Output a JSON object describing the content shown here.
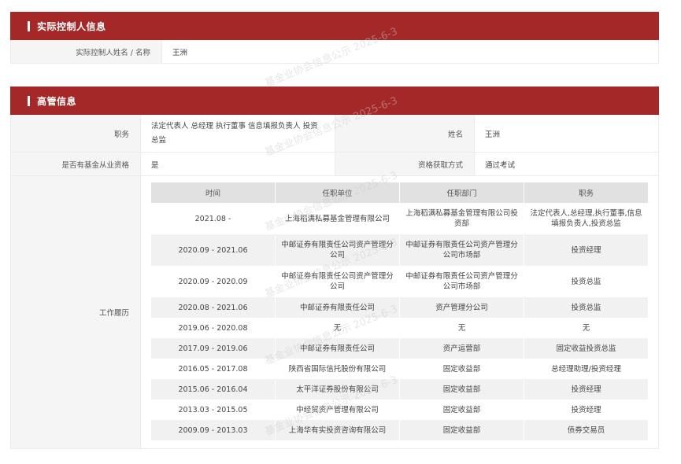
{
  "controller": {
    "section_title": "实际控制人信息",
    "name_label": "实际控制人姓名 / 名称",
    "name_value": "王洲"
  },
  "executive": {
    "section_title": "高管信息",
    "position_label": "职务",
    "position_value": "法定代表人 总经理 执行董事 信息填报负责人 投资总监",
    "name_label": "姓名",
    "name_value": "王洲",
    "fund_qual_label": "是否有基金从业资格",
    "fund_qual_value": "是",
    "qual_method_label": "资格获取方式",
    "qual_method_value": "通过考试",
    "history_label": "工作履历",
    "history": {
      "headers": [
        "时间",
        "任职单位",
        "任职部门",
        "职务"
      ],
      "rows": [
        {
          "time": "2021.08 -",
          "company": "上海稻满私募基金管理有限公司",
          "dept": "上海稻满私募基金管理有限公司投资部",
          "title": "法定代表人,总经理,执行董事,信息填报负责人,投资总监"
        },
        {
          "time": "2020.09 - 2021.06",
          "company": "中邮证券有限责任公司资产管理分公司",
          "dept": "中邮证券有限责任公司资产管理分公司市场部",
          "title": "投资经理"
        },
        {
          "time": "2020.09 - 2020.09",
          "company": "中邮证券有限责任公司资产管理分公司",
          "dept": "中邮证券有限责任公司资产管理分公司市场部",
          "title": "投资总监"
        },
        {
          "time": "2020.08 - 2021.06",
          "company": "中邮证券有限责任公司",
          "dept": "资产管理分公司",
          "title": "投资总监"
        },
        {
          "time": "2019.06 - 2020.08",
          "company": "无",
          "dept": "无",
          "title": "无"
        },
        {
          "time": "2017.09 - 2019.06",
          "company": "中邮证券有限责任公司",
          "dept": "资产运营部",
          "title": "固定收益投资总监"
        },
        {
          "time": "2016.05 - 2017.08",
          "company": "陕西省国际信托股份有限公司",
          "dept": "固定收益部",
          "title": "总经理助理/投资经理"
        },
        {
          "time": "2015.06 - 2016.04",
          "company": "太平洋证券股份有限公司",
          "dept": "固定收益部",
          "title": "投资经理"
        },
        {
          "time": "2013.03 - 2015.05",
          "company": "中经贸资产管理有限公司",
          "dept": "固定收益部",
          "title": "投资经理"
        },
        {
          "time": "2009.09 - 2013.03",
          "company": "上海华有实投资咨询有限公司",
          "dept": "固定收益部",
          "title": "债券交易员"
        }
      ]
    }
  },
  "watermark": {
    "text": "基金业协会信息公示 2025-6-3"
  }
}
